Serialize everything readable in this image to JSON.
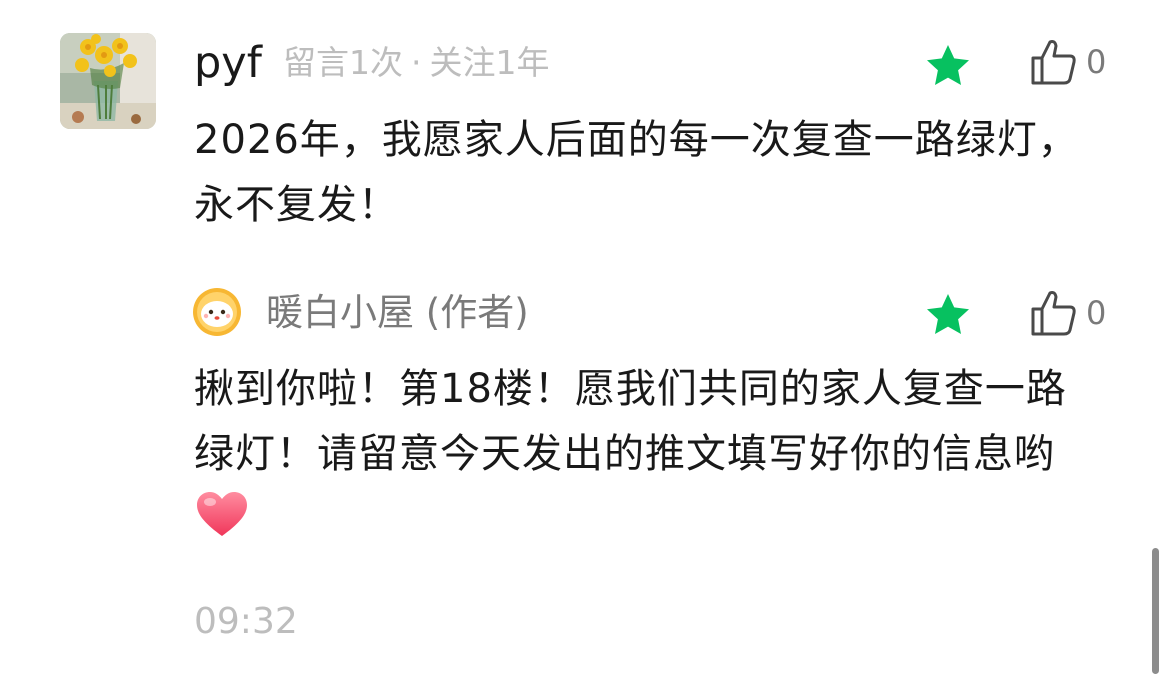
{
  "comment": {
    "avatar_icon": "daffodil-photo-avatar",
    "username": "pyf",
    "meta_count": "留言1次",
    "meta_separator": "·",
    "meta_follow": "关注1年",
    "text": "2026年，我愿家人后面的每一次复查一路绿灯，永不复发！",
    "like_count": "0",
    "starred": true
  },
  "reply": {
    "avatar_icon": "cartoon-face-avatar",
    "author": "暖白小屋 (作者)",
    "text": "揪到你啦！第18楼！愿我们共同的家人复查一路绿灯！请留意今天发出的推文填写好你的信息哟",
    "emoji": "heart-emoji",
    "like_count": "0",
    "starred": true
  },
  "timestamp": "09:32",
  "colors": {
    "star": "#07c160",
    "meta_gray": "#bdbdbd",
    "heart": "#ff4f6e"
  }
}
